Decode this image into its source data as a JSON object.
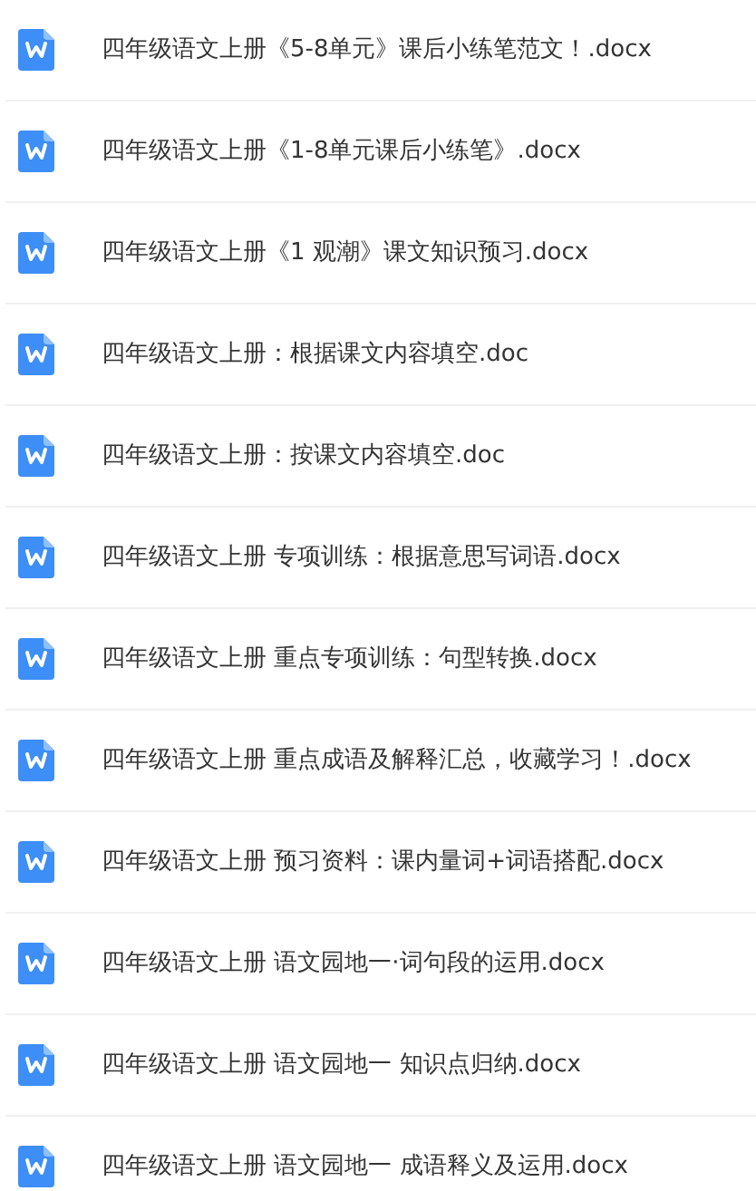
{
  "files": [
    {
      "name": "四年级语文上册《5-8单元》课后小练笔范文！.docx"
    },
    {
      "name": "四年级语文上册《1-8单元课后小练笔》.docx"
    },
    {
      "name": "四年级语文上册《1 观潮》课文知识预习.docx"
    },
    {
      "name": "四年级语文上册：根据课文内容填空.doc"
    },
    {
      "name": "四年级语文上册：按课文内容填空.doc"
    },
    {
      "name": "四年级语文上册 专项训练：根据意思写词语.docx"
    },
    {
      "name": "四年级语文上册 重点专项训练：句型转换.docx"
    },
    {
      "name": "四年级语文上册 重点成语及解释汇总，收藏学习！.docx"
    },
    {
      "name": "四年级语文上册 预习资料：课内量词+词语搭配.docx"
    },
    {
      "name": "四年级语文上册 语文园地一·词句段的运用.docx"
    },
    {
      "name": "四年级语文上册 语文园地一 知识点归纳.docx"
    },
    {
      "name": "四年级语文上册 语文园地一 成语释义及运用.docx"
    }
  ]
}
